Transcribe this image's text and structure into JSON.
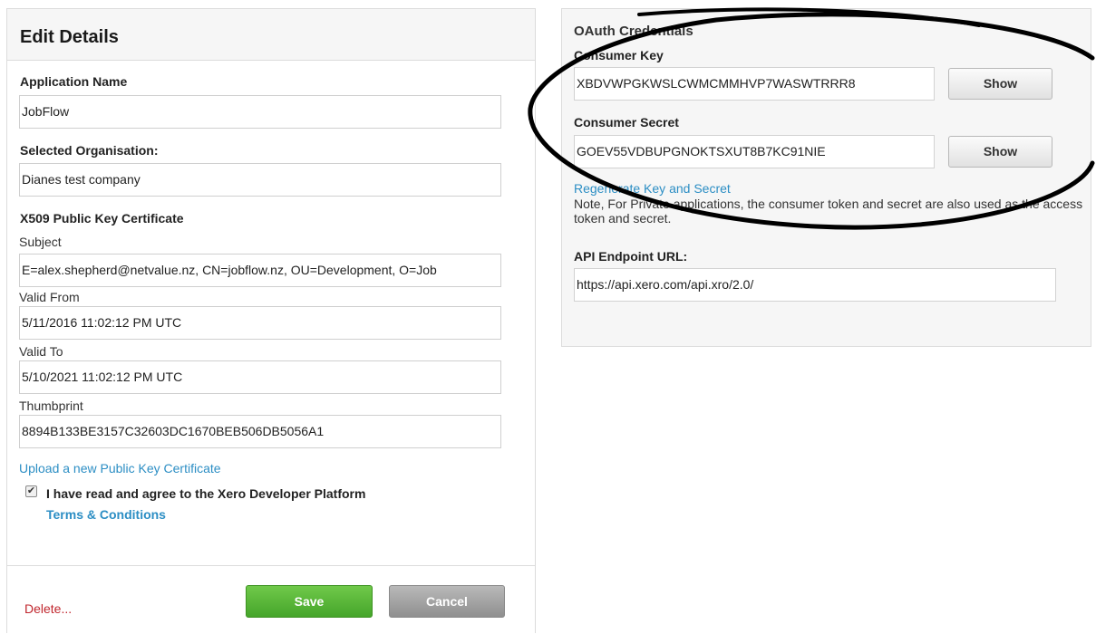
{
  "edit_details": {
    "title": "Edit Details",
    "application_name_label": "Application Name",
    "application_name_value": "JobFlow",
    "organisation_label": "Selected Organisation:",
    "organisation_value": "Dianes test company",
    "certificate_heading": "X509 Public Key Certificate",
    "subject_label": "Subject",
    "subject_value": "E=alex.shepherd@netvalue.nz, CN=jobflow.nz, OU=Development, O=Job",
    "valid_from_label": "Valid From",
    "valid_from_value": "5/11/2016 11:02:12 PM UTC",
    "valid_to_label": "Valid To",
    "valid_to_value": "5/10/2021 11:02:12 PM UTC",
    "thumbprint_label": "Thumbprint",
    "thumbprint_value": "8894B133BE3157C32603DC1670BEB506DB5056A1",
    "upload_link": "Upload a new Public Key Certificate",
    "agree_checked": true,
    "agree_text": "I have read and agree to the Xero Developer Platform",
    "terms_link": "Terms & Conditions"
  },
  "footer": {
    "delete_label": "Delete...",
    "save_label": "Save",
    "cancel_label": "Cancel"
  },
  "oauth": {
    "title": "OAuth Credentials",
    "consumer_key_label": "Consumer Key",
    "consumer_key_value": "XBDVWPGKWSLCWMCMMHVP7WASWTRRR8",
    "show_label": "Show",
    "consumer_secret_label": "Consumer Secret",
    "consumer_secret_value": "GOEV55VDBUPGNOKTSXUT8B7KC91NIE",
    "regenerate_link": "Regenerate Key and Secret",
    "note": "Note, For Private applications, the consumer token and secret are also used as the access token and secret.",
    "api_endpoint_label": "API Endpoint URL:",
    "api_endpoint_value": "https://api.xero.com/api.xro/2.0/"
  },
  "colors": {
    "link": "#2c8ec4",
    "delete": "#c0262d",
    "save": "#45a52a",
    "cancel": "#8f8f8f"
  }
}
